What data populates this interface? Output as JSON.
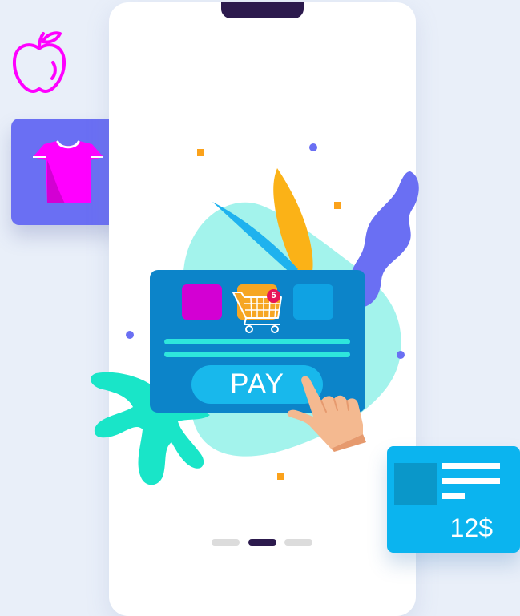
{
  "payment": {
    "pay_label": "PAY",
    "cart_badge_count": "5"
  },
  "price_card": {
    "price": "12$"
  },
  "icons": {
    "apple": "apple-icon",
    "shirt": "tshirt-icon",
    "cart": "shopping-cart-icon",
    "hand": "pointing-hand-icon"
  },
  "pagination": {
    "count": 3,
    "active_index": 1
  },
  "colors": {
    "background": "#e9eff9",
    "phone": "#ffffff",
    "notch": "#2c1a4d",
    "purple_card": "#6a6ff3",
    "magenta": "#ff00ff",
    "pay_card": "#0c84c9",
    "pay_button": "#18b8ec",
    "price_card": "#0bb4ef",
    "teal_splash": "#19e5c8",
    "mint_blob": "#a3f3ec",
    "orange_leaf": "#fbb217",
    "blue_leaf": "#1fb2ee",
    "confetti_orange": "#fba21b",
    "skin": "#f4b990"
  }
}
